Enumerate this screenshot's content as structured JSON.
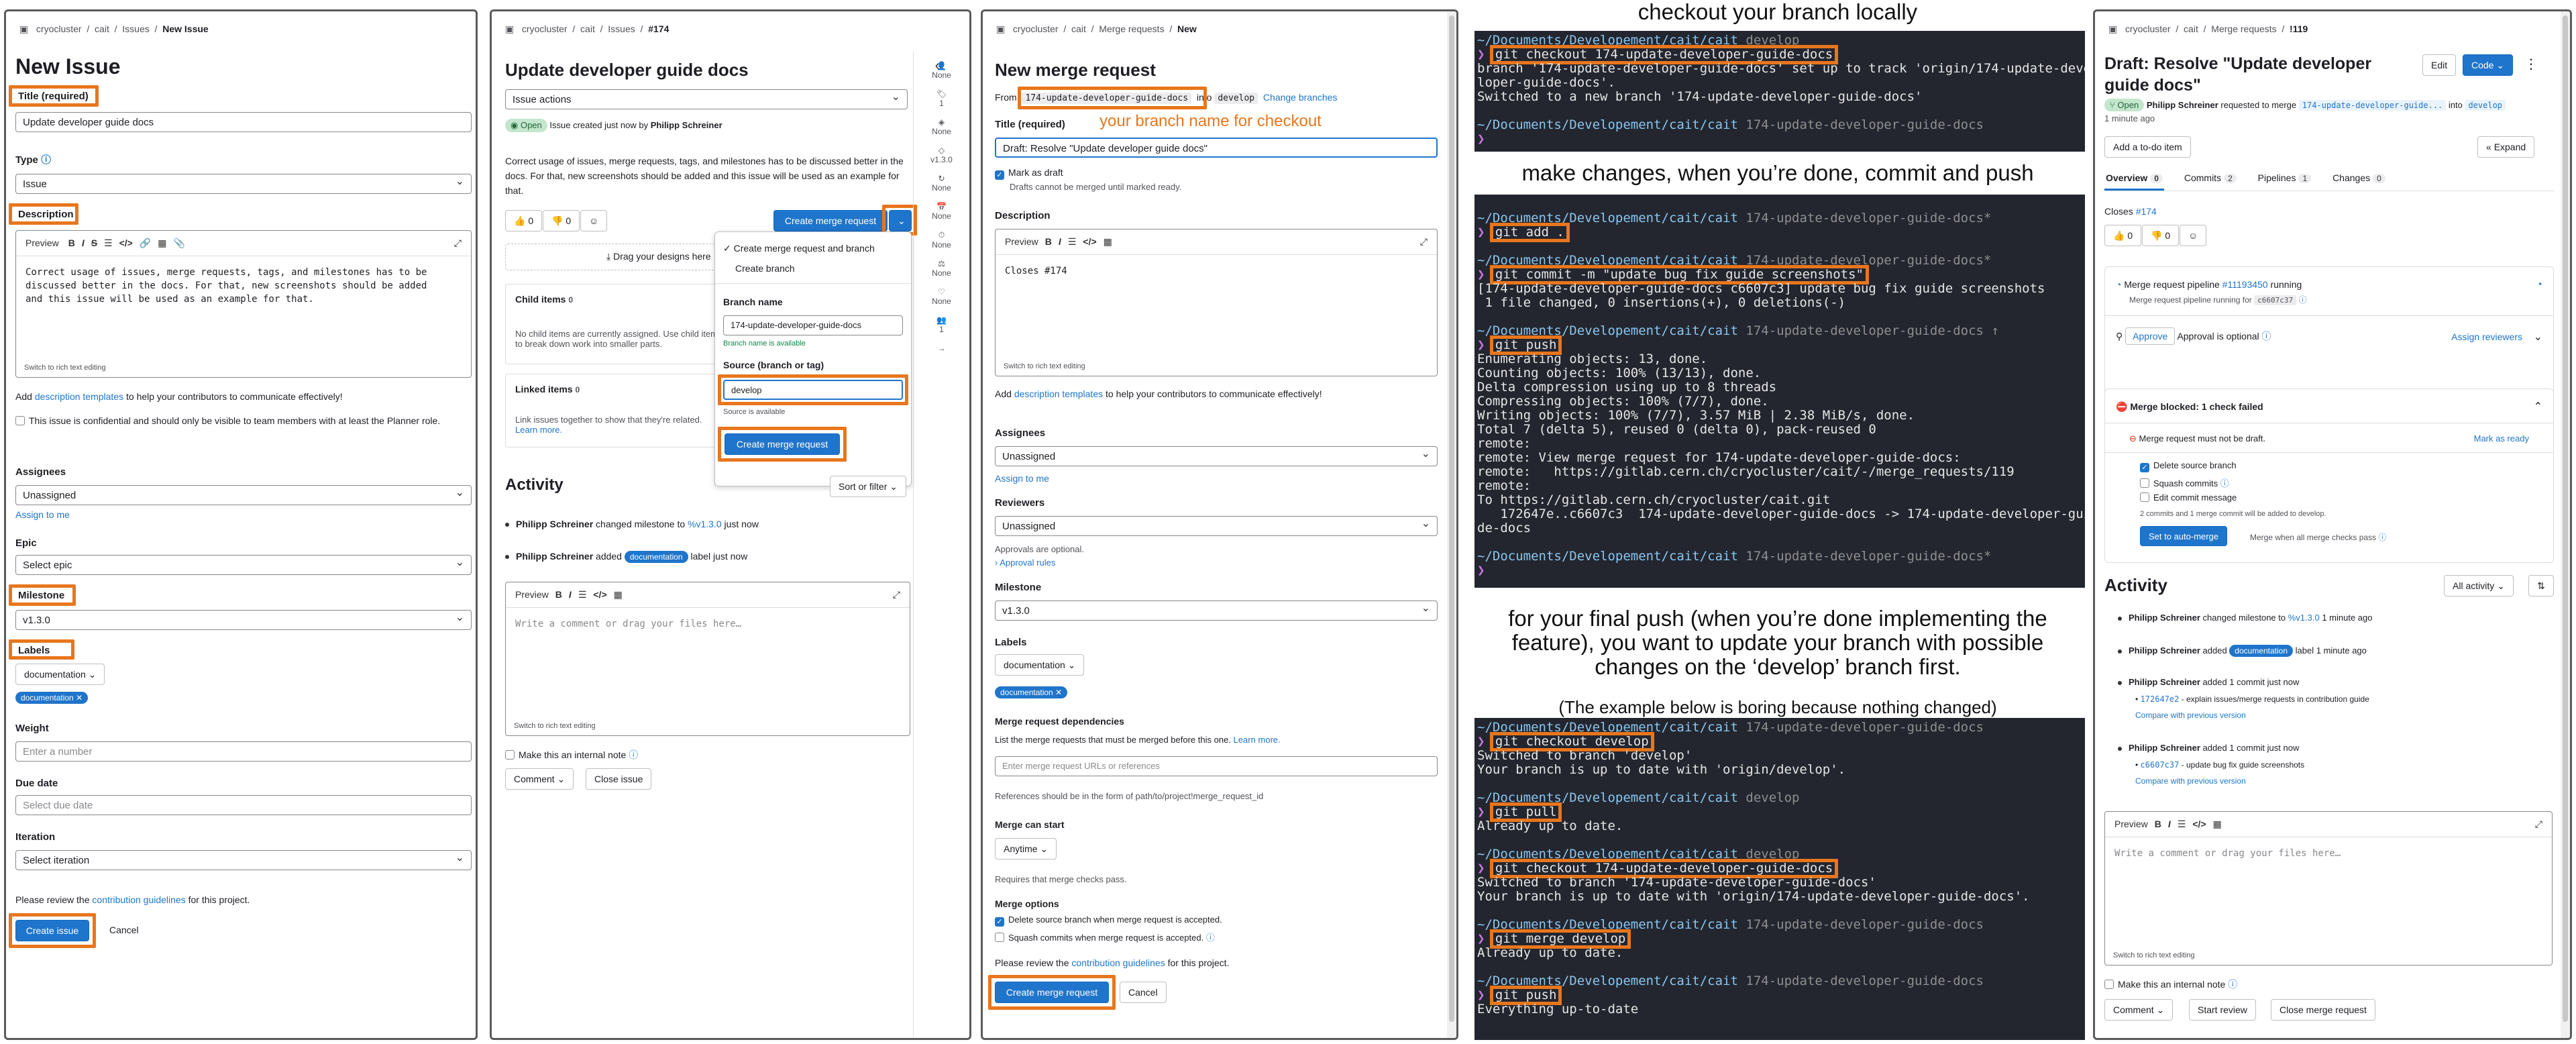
{
  "p1": {
    "breadcrumb": [
      "cryocluster",
      "cait",
      "Issues",
      "New Issue"
    ],
    "title": "New Issue",
    "title_label": "Title (required)",
    "title_value": "Update developer guide docs",
    "type_label": "Type",
    "type_value": "Issue",
    "desc_label": "Description",
    "desc_tab": "Preview",
    "desc_text": "Correct usage of issues, merge requests, tags, and milestones has to be\ndiscussed better in the docs. For that, new screenshots should be added\nand this issue will be used as an example for that.",
    "switch_rich": "Switch to rich text editing",
    "add_desc_pre": "Add ",
    "add_desc_link": "description templates",
    "add_desc_post": " to help your contributors to communicate effectively!",
    "confidential": "This issue is confidential and should only be visible to team members with at least the Planner role.",
    "assignees_label": "Assignees",
    "assignees_value": "Unassigned",
    "assign_me": "Assign to me",
    "epic_label": "Epic",
    "epic_value": "Select epic",
    "milestone_label": "Milestone",
    "milestone_value": "v1.3.0",
    "labels_label": "Labels",
    "labels_dropdown": "documentation",
    "labels_chip": "documentation",
    "weight_label": "Weight",
    "weight_placeholder": "Enter a number",
    "due_label": "Due date",
    "due_placeholder": "Select due date",
    "iteration_label": "Iteration",
    "iteration_value": "Select iteration",
    "review_pre": "Please review the ",
    "review_link": "contribution guidelines",
    "review_post": " for this project.",
    "create_btn": "Create issue",
    "cancel_btn": "Cancel"
  },
  "p2": {
    "breadcrumb": [
      "cryocluster",
      "cait",
      "Issues",
      "#174"
    ],
    "title": "Update developer guide docs",
    "issue_actions": "Issue actions",
    "open_badge": "Open",
    "created_pre": "Issue created just now by ",
    "created_by": "Philipp Schreiner",
    "desc": "Correct usage of issues, merge requests, tags, and milestones has to be discussed better in the docs. For that, new screenshots should be added and this issue will be used as an example for that.",
    "thumbs_up": "0",
    "thumbs_down": "0",
    "create_mr_btn": "Create merge request",
    "drag_designs": "Drag your designs here",
    "child_items": "Child items",
    "child_count": "0",
    "child_empty": "No child items are currently assigned. Use child items to break down work into smaller parts.",
    "linked_items": "Linked items",
    "linked_count": "0",
    "linked_text": "Link issues together to show that they're related.",
    "learn_more": "Learn more.",
    "activity": "Activity",
    "sort_filter": "Sort or filter",
    "act1_user": "Philipp Schreiner",
    "act1_text": " changed milestone to ",
    "act1_link": "%v1.3.0",
    "act1_time": " just now",
    "act2_user": "Philipp Schreiner",
    "act2_text": " added ",
    "act2_chip": "documentation",
    "act2_post": " label just now",
    "comment_tab": "Preview",
    "comment_placeholder": "Write a comment or drag your files here…",
    "switch_rich": "Switch to rich text editing",
    "internal_note": "Make this an internal note",
    "comment_btn": "Comment",
    "close_btn": "Close issue",
    "dropdown": {
      "opt1": "Create merge request and branch",
      "opt2": "Create branch",
      "branch_label": "Branch name",
      "branch_value": "174-update-developer-guide-docs",
      "branch_ok": "Branch name is available",
      "source_label": "Source (branch or tag)",
      "source_value": "develop",
      "source_ok": "Source is available",
      "create_btn": "Create merge request"
    },
    "side": [
      "None",
      "1",
      "None",
      "v1.3.0",
      "None",
      "None",
      "None",
      "None",
      "None",
      "1"
    ]
  },
  "p3": {
    "breadcrumb": [
      "cryocluster",
      "cait",
      "Merge requests",
      "New"
    ],
    "title": "New merge request",
    "from_label": "From",
    "from_branch": "174-update-developer-guide-docs",
    "into_label": "into",
    "into_branch": "develop",
    "change_branches": "Change branches",
    "annotation": "your branch name for checkout",
    "title_label": "Title (required)",
    "title_value": "Draft: Resolve \"Update developer guide docs\"",
    "draft_label": "Mark as draft",
    "draft_help": "Drafts cannot be merged until marked ready.",
    "desc_label": "Description",
    "desc_tab": "Preview",
    "desc_text": "Closes #174",
    "switch_rich": "Switch to rich text editing",
    "add_desc_pre": "Add ",
    "add_desc_link": "description templates",
    "add_desc_post": " to help your contributors to communicate effectively!",
    "assignees_label": "Assignees",
    "assignees_value": "Unassigned",
    "assign_me": "Assign to me",
    "reviewers_label": "Reviewers",
    "reviewers_value": "Unassigned",
    "approvals_optional": "Approvals are optional.",
    "approval_rules": "Approval rules",
    "milestone_label": "Milestone",
    "milestone_value": "v1.3.0",
    "labels_label": "Labels",
    "labels_dropdown": "documentation",
    "labels_chip": "documentation",
    "deps_label": "Merge request dependencies",
    "deps_help": "List the merge requests that must be merged before this one.",
    "learn_more": "Learn more.",
    "deps_placeholder": "Enter merge request URLs or references",
    "deps_note": "References should be in the form of path/to/project!merge_request_id",
    "start_label": "Merge can start",
    "start_value": "Anytime",
    "start_help": "Requires that merge checks pass.",
    "options_label": "Merge options",
    "opt_delete": "Delete source branch when merge request is accepted.",
    "opt_squash": "Squash commits when merge request is accepted.",
    "review_pre": "Please review the ",
    "review_link": "contribution guidelines",
    "review_post": " for this project.",
    "create_btn": "Create merge request",
    "cancel_btn": "Cancel"
  },
  "p4": {
    "caption1": "checkout your branch locally",
    "caption2": "make changes, when you’re done, commit and push",
    "caption3": "for your final push (when you’re done implementing the feature), you want to update your branch with possible changes on the ‘develop’ branch first.",
    "caption4": "(The example below is boring because nothing changed)",
    "path": "~/Documents/Developement/cait/cait",
    "term1": {
      "b0": "develop",
      "cmd": "git checkout 174-update-developer-guide-docs",
      "out": [
        "branch '174-update-developer-guide-docs' set up to track 'origin/174-update-deve",
        "loper-guide-docs'.",
        "Switched to a new branch '174-update-developer-guide-docs'"
      ],
      "b1": "174-update-developer-guide-docs"
    },
    "term2": {
      "b0": "174-update-developer-guide-docs*",
      "cmd1": "git add .",
      "b1": "174-update-developer-guide-docs*",
      "cmd2": "git commit -m \"update bug fix guide screenshots\"",
      "out2": [
        "[174-update-developer-guide-docs c6607c3] update bug fix guide screenshots",
        " 1 file changed, 0 insertions(+), 0 deletions(-)"
      ],
      "b2": "174-update-developer-guide-docs ↑",
      "cmd3": "git push",
      "out3": [
        "Enumerating objects: 13, done.",
        "Counting objects: 100% (13/13), done.",
        "Delta compression using up to 8 threads",
        "Compressing objects: 100% (7/7), done.",
        "Writing objects: 100% (7/7), 3.57 MiB | 2.38 MiB/s, done.",
        "Total 7 (delta 5), reused 0 (delta 0), pack-reused 0",
        "remote:",
        "remote: View merge request for 174-update-developer-guide-docs:",
        "remote:   https://gitlab.cern.ch/cryocluster/cait/-/merge_requests/119",
        "remote:",
        "To https://gitlab.cern.ch/cryocluster/cait.git",
        "   172647e..c6607c3  174-update-developer-guide-docs -> 174-update-developer-gui",
        "de-docs"
      ]
    },
    "term3": {
      "b0": "174-update-developer-guide-docs",
      "cmd1": "git checkout develop",
      "out1": [
        "Switched to branch 'develop'",
        "Your branch is up to date with 'origin/develop'."
      ],
      "b1": "develop",
      "cmd2": "git pull",
      "out2": [
        "Already up to date."
      ],
      "b2": "develop",
      "cmd3": "git checkout 174-update-developer-guide-docs",
      "out3": [
        "Switched to branch '174-update-developer-guide-docs'",
        "Your branch is up to date with 'origin/174-update-developer-guide-docs'."
      ],
      "b3": "174-update-developer-guide-docs",
      "cmd4": "git merge develop",
      "out4": [
        "Already up to date."
      ],
      "b4": "174-update-developer-guide-docs",
      "cmd5": "git push",
      "out5": [
        "Everything up-to-date"
      ]
    }
  },
  "p5": {
    "breadcrumb": [
      "cryocluster",
      "cait",
      "Merge requests",
      "!119"
    ],
    "title": "Draft: Resolve \"Update developer guide docs\"",
    "edit_btn": "Edit",
    "code_btn": "Code",
    "open_badge": "Open",
    "req_user": "Philipp Schreiner",
    "req_text": " requested to merge ",
    "req_src": "174-update-developer-guide...",
    "req_into": " into ",
    "req_dst": "develop",
    "time_ago": "1 minute ago",
    "todo_btn": "Add a to-do item",
    "expand_btn": "Expand",
    "tabs": [
      {
        "label": "Overview",
        "count": "0"
      },
      {
        "label": "Commits",
        "count": "2"
      },
      {
        "label": "Pipelines",
        "count": "1"
      },
      {
        "label": "Changes",
        "count": "0"
      }
    ],
    "closes_pre": "Closes ",
    "closes_link": "#174",
    "thumbs_up": "0",
    "thumbs_down": "0",
    "pipe_pre": "Merge request pipeline ",
    "pipe_link": "#11193450",
    "pipe_post": " running",
    "pipe_sub_pre": "Merge request pipeline running for ",
    "pipe_sub_code": "c6607c37",
    "approve_btn": "Approve",
    "approval_text": "Approval is optional",
    "assign_reviewers": "Assign reviewers",
    "blocked_title": "Merge blocked: 1 check failed",
    "not_draft": "Merge request must not be draft.",
    "mark_ready": "Mark as ready",
    "delete_src": "Delete source branch",
    "squash": "Squash commits",
    "edit_commit": "Edit commit message",
    "commits_note_pre": "2 commits and 1 merge commit will be added to ",
    "commits_note_dst": "develop",
    "auto_merge_btn": "Set to auto-merge",
    "auto_merge_note": "Merge when all merge checks pass",
    "activity": "Activity",
    "all_activity": "All activity",
    "act1_user": "Philipp Schreiner",
    "act1_text": " changed milestone to ",
    "act1_link": "%v1.3.0",
    "act1_time": " 1 minute ago",
    "act2_user": "Philipp Schreiner",
    "act2_text": " added ",
    "act2_chip": "documentation",
    "act2_time": " label 1 minute ago",
    "act3_user": "Philipp Schreiner",
    "act3_text": " added 1 commit just now",
    "act3_commit": "172647e2",
    "act3_msg": " - explain issues/merge requests in contribution guide",
    "act3_compare": "Compare with previous version",
    "act4_user": "Philipp Schreiner",
    "act4_text": " added 1 commit just now",
    "act4_commit": "c6607c37",
    "act4_msg": " - update bug fix guide screenshots",
    "act4_compare": "Compare with previous version",
    "comment_tab": "Preview",
    "comment_placeholder": "Write a comment or drag your files here…",
    "switch_rich": "Switch to rich text editing",
    "internal_note": "Make this an internal note",
    "comment_btn": "Comment",
    "review_btn": "Start review",
    "close_btn": "Close merge request"
  },
  "colors": {
    "highlight": "#e8761d",
    "primary": "#1f75cb",
    "terminal_bg": "#23262f"
  }
}
